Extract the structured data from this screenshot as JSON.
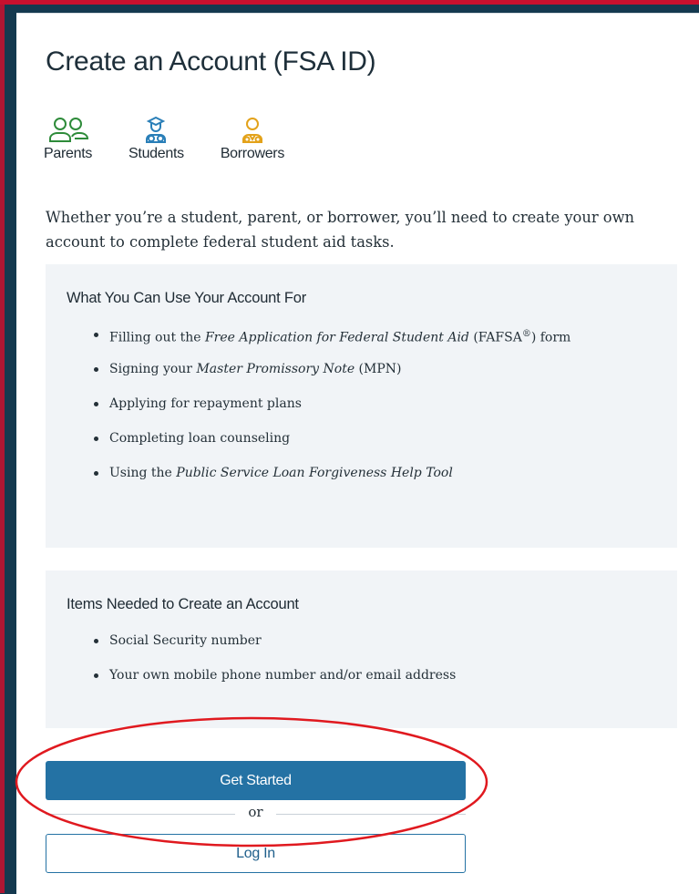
{
  "page": {
    "title": "Create an Account (FSA ID)",
    "roles": [
      {
        "label": "Parents",
        "icon": "parents-icon",
        "color": "#2e8b3a"
      },
      {
        "label": "Students",
        "icon": "students-icon",
        "color": "#2a7fb8"
      },
      {
        "label": "Borrowers",
        "icon": "borrowers-icon",
        "color": "#e3a21a"
      }
    ],
    "intro": "Whether you’re a student, parent, or borrower, you’ll need to create your own account to complete federal student aid tasks."
  },
  "uses": {
    "heading": "What You Can Use Your Account For",
    "items": {
      "fafsa_pre": "Filling out the ",
      "fafsa_em": "Free Application for Federal Student Aid",
      "fafsa_mid": " (FAFSA",
      "fafsa_reg": "®",
      "fafsa_post": ") form",
      "mpn_pre": "Signing your ",
      "mpn_em": "Master Promissory Note",
      "mpn_post": " (MPN)",
      "repayment": "Applying for repayment plans",
      "counseling": "Completing loan counseling",
      "pslf_pre": "Using the ",
      "pslf_em": "Public Service Loan Forgiveness Help Tool"
    }
  },
  "needed": {
    "heading": "Items Needed to Create an Account",
    "items": [
      "Social Security number",
      "Your own mobile phone number and/or email address"
    ]
  },
  "actions": {
    "get_started": "Get Started",
    "or": "or",
    "log_in": "Log In"
  },
  "colors": {
    "primary_button": "#2472a4",
    "annotation": "#e0191f",
    "background": "#14394f"
  }
}
